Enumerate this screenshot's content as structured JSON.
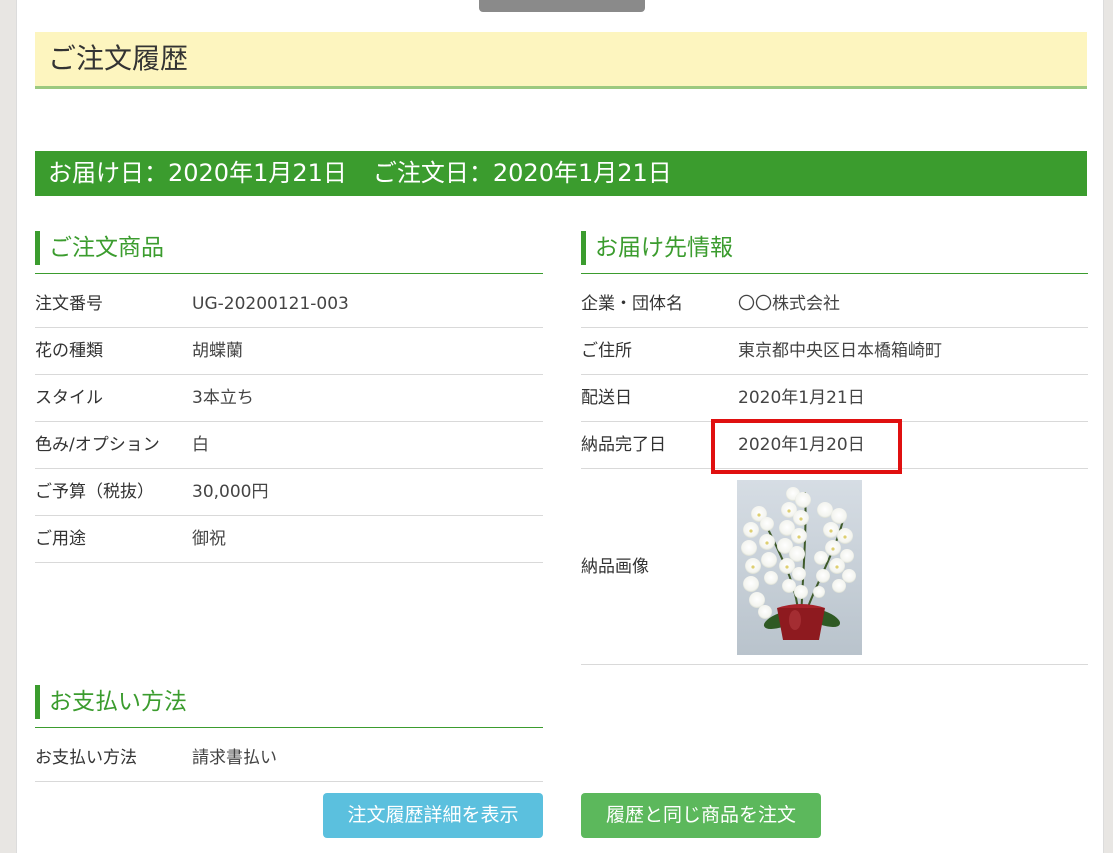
{
  "page": {
    "title": "ご注文履歴"
  },
  "banner": {
    "delivery": "お届け日：2020年1月21日",
    "ordered": "ご注文日：2020年1月21日"
  },
  "order_items": {
    "heading": "ご注文商品",
    "rows": [
      {
        "label": "注文番号",
        "value": "UG-20200121-003"
      },
      {
        "label": "花の種類",
        "value": "胡蝶蘭"
      },
      {
        "label": "スタイル",
        "value": "3本立ち"
      },
      {
        "label": "色み/オプション",
        "value": "白"
      },
      {
        "label": "ご予算（税抜）",
        "value": "30,000円"
      },
      {
        "label": "ご用途",
        "value": "御祝"
      }
    ]
  },
  "shipping": {
    "heading": "お届け先情報",
    "rows": [
      {
        "label": "企業・団体名",
        "value": "〇〇株式会社"
      },
      {
        "label": "ご住所",
        "value": "東京都中央区日本橋箱崎町"
      },
      {
        "label": "配送日",
        "value": "2020年1月21日"
      },
      {
        "label": "納品完了日",
        "value": "2020年1月20日"
      }
    ],
    "image_label": "納品画像",
    "image_icon": "orchid-photo"
  },
  "payment": {
    "heading": "お支払い方法",
    "rows": [
      {
        "label": "お支払い方法",
        "value": "請求書払い"
      }
    ]
  },
  "buttons": {
    "detail": "注文履歴詳細を表示",
    "reorder": "履歴と同じ商品を注文"
  },
  "colors": {
    "accent_green": "#3b9c2e",
    "title_bg": "#fdf5bf",
    "highlight_red": "#e01010",
    "button_blue": "#5bc0de",
    "button_green": "#5cb85c"
  }
}
